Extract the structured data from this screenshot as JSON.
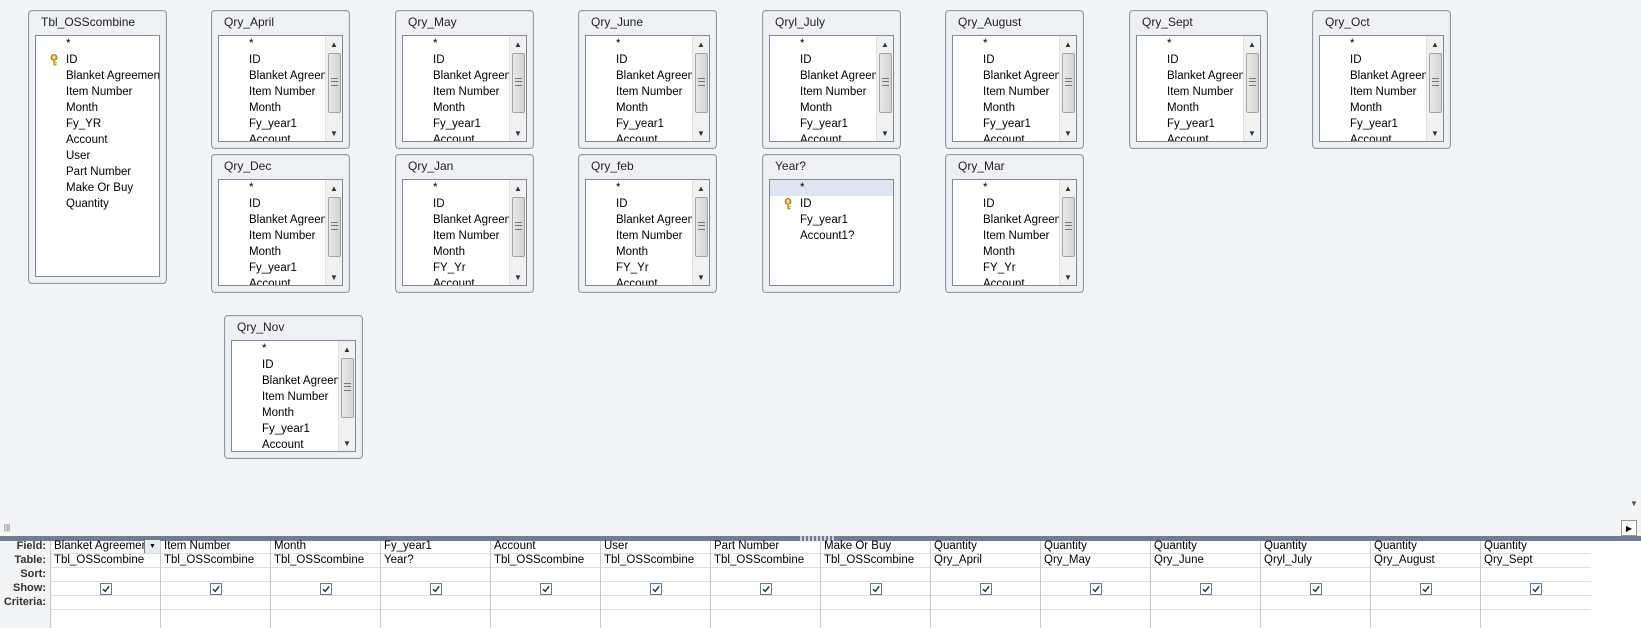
{
  "field_lists": [
    {
      "id": "tbl-osscombine",
      "title": "Tbl_OSScombine",
      "scroll": false,
      "fields": [
        "*",
        "ID",
        "Blanket Agreement",
        "Item Number",
        "Month",
        "Fy_YR",
        "Account",
        "User",
        "Part Number",
        "Make Or Buy",
        "Quantity"
      ],
      "key_index": 1
    },
    {
      "id": "qry-april",
      "title": "Qry_April",
      "scroll": true,
      "fields": [
        "*",
        "ID",
        "Blanket Agreem",
        "Item Number",
        "Month",
        "Fy_year1",
        "Account"
      ]
    },
    {
      "id": "qry-may",
      "title": "Qry_May",
      "scroll": true,
      "fields": [
        "*",
        "ID",
        "Blanket Agreem",
        "Item Number",
        "Month",
        "Fy_year1",
        "Account"
      ]
    },
    {
      "id": "qry-june",
      "title": "Qry_June",
      "scroll": true,
      "fields": [
        "*",
        "ID",
        "Blanket Agreem",
        "Item Number",
        "Month",
        "Fy_year1",
        "Account"
      ]
    },
    {
      "id": "qryl-july",
      "title": "Qryl_July",
      "scroll": true,
      "fields": [
        "*",
        "ID",
        "Blanket Agreem",
        "Item Number",
        "Month",
        "Fy_year1",
        "Account"
      ]
    },
    {
      "id": "qry-august",
      "title": "Qry_August",
      "scroll": true,
      "fields": [
        "*",
        "ID",
        "Blanket Agreem",
        "Item Number",
        "Month",
        "Fy_year1",
        "Account"
      ]
    },
    {
      "id": "qry-sept",
      "title": "Qry_Sept",
      "scroll": true,
      "fields": [
        "*",
        "ID",
        "Blanket Agreem",
        "Item Number",
        "Month",
        "Fy_year1",
        "Account"
      ]
    },
    {
      "id": "qry-oct",
      "title": "Qry_Oct",
      "scroll": true,
      "fields": [
        "*",
        "ID",
        "Blanket Agreem",
        "Item Number",
        "Month",
        "Fy_year1",
        "Account"
      ]
    },
    {
      "id": "qry-dec",
      "title": "Qry_Dec",
      "scroll": true,
      "fields": [
        "*",
        "ID",
        "Blanket Agreem",
        "Item Number",
        "Month",
        "Fy_year1",
        "Account"
      ]
    },
    {
      "id": "qry-jan",
      "title": "Qry_Jan",
      "scroll": true,
      "fields": [
        "*",
        "ID",
        "Blanket Agreem",
        "Item Number",
        "Month",
        "FY_Yr",
        "Account"
      ]
    },
    {
      "id": "qry-feb",
      "title": "Qry_feb",
      "scroll": true,
      "fields": [
        "*",
        "ID",
        "Blanket Agreem",
        "Item Number",
        "Month",
        "FY_Yr",
        "Account"
      ]
    },
    {
      "id": "year",
      "title": "Year?",
      "scroll": false,
      "fields": [
        "*",
        "ID",
        "Fy_year1",
        "Account1?"
      ],
      "key_index": 1,
      "selected_index": 0
    },
    {
      "id": "qry-mar",
      "title": "Qry_Mar",
      "scroll": true,
      "fields": [
        "*",
        "ID",
        "Blanket Agreem",
        "Item Number",
        "Month",
        "FY_Yr",
        "Account"
      ]
    },
    {
      "id": "qry-nov",
      "title": "Qry_Nov",
      "scroll": true,
      "fields": [
        "*",
        "ID",
        "Blanket Agreem",
        "Item Number",
        "Month",
        "Fy_year1",
        "Account"
      ]
    }
  ],
  "grid": {
    "row_labels": [
      "Field:",
      "Table:",
      "Sort:",
      "Show:",
      "Criteria:"
    ],
    "columns": [
      {
        "field": "Blanket Agreemen",
        "table": "Tbl_OSScombine",
        "show": true
      },
      {
        "field": "Item Number",
        "table": "Tbl_OSScombine",
        "show": true
      },
      {
        "field": "Month",
        "table": "Tbl_OSScombine",
        "show": true
      },
      {
        "field": "Fy_year1",
        "table": "Year?",
        "show": true
      },
      {
        "field": "Account",
        "table": "Tbl_OSScombine",
        "show": true
      },
      {
        "field": "User",
        "table": "Tbl_OSScombine",
        "show": true
      },
      {
        "field": "Part Number",
        "table": "Tbl_OSScombine",
        "show": true
      },
      {
        "field": "Make Or Buy",
        "table": "Tbl_OSScombine",
        "show": true
      },
      {
        "field": "Quantity",
        "table": "Qry_April",
        "show": true
      },
      {
        "field": "Quantity",
        "table": "Qry_May",
        "show": true
      },
      {
        "field": "Quantity",
        "table": "Qry_June",
        "show": true
      },
      {
        "field": "Quantity",
        "table": "Qryl_July",
        "show": true
      },
      {
        "field": "Quantity",
        "table": "Qry_August",
        "show": true
      },
      {
        "field": "Quantity",
        "table": "Qry_Sept",
        "show": true
      }
    ]
  }
}
